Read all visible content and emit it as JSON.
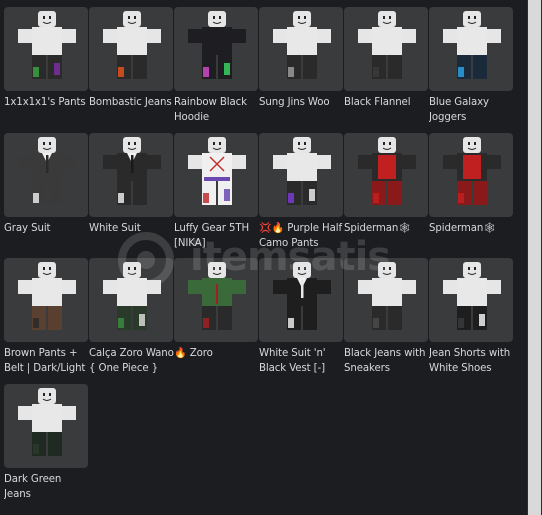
{
  "items": [
    {
      "name": "1x1x1x1's Pants",
      "torso": "#e8e8e8",
      "legs": "#2a2a2a",
      "accent": "#3aa040",
      "accent2": "#7a2fa0",
      "tie": ""
    },
    {
      "name": "Bombastic Jeans",
      "torso": "#e8e8e8",
      "legs": "#2a2a2a",
      "accent": "#e0521e",
      "accent2": "#2a2a2a",
      "tie": ""
    },
    {
      "name": "Rainbow Black Hoodie",
      "torso": "#1e1e22",
      "legs": "#1e1e22",
      "accent": "#d04ac8",
      "accent2": "#3ad060",
      "tie": ""
    },
    {
      "name": "Sung Jins Woo",
      "torso": "#e8e8e8",
      "legs": "#2a2a2a",
      "accent": "#9a9a9a",
      "accent2": "#2a2a2a",
      "tie": ""
    },
    {
      "name": "Black Flannel",
      "torso": "#e8e8e8",
      "legs": "#2a2a2a",
      "accent": "#3a3a3a",
      "accent2": "#2a2a2a",
      "tie": ""
    },
    {
      "name": "Blue Galaxy Joggers",
      "torso": "#e8e8e8",
      "legs": "#1a2a3a",
      "accent": "#2aa0e0",
      "accent2": "#1a2a3a",
      "tie": ""
    },
    {
      "name": "Gray Suit",
      "torso": "#3a3a3a",
      "legs": "#3a3a3a",
      "accent": "#e8e8e8",
      "accent2": "#3a3a3a",
      "tie": "#2a2a2a"
    },
    {
      "name": "White Suit",
      "torso": "#2a2a2a",
      "legs": "#2a2a2a",
      "accent": "#e8e8e8",
      "accent2": "#2a2a2a",
      "tie": "#1a1a1a"
    },
    {
      "name": "Luffy Gear 5TH [NIKA]",
      "torso": "#f0f0f0",
      "legs": "#f0f0f0",
      "accent": "#c03030",
      "accent2": "#6a4ab0",
      "tie": ""
    },
    {
      "name": "💢🔥 Purple Half Camo Pants",
      "torso": "#e8e8e8",
      "legs": "#2a2a2a",
      "accent": "#7a3ad0",
      "accent2": "#e8e8e8",
      "tie": ""
    },
    {
      "name": "Spiderman🕸",
      "torso": "#2a2a2a",
      "legs": "#8a1a1a",
      "accent": "#c02020",
      "accent2": "#8a1a1a",
      "tie": ""
    },
    {
      "name": "Spiderman🕸",
      "torso": "#2a2a2a",
      "legs": "#8a1a1a",
      "accent": "#c02020",
      "accent2": "#8a1a1a",
      "tie": ""
    },
    {
      "name": "Brown Pants + Belt | Dark/Light",
      "torso": "#e8e8e8",
      "legs": "#5a4030",
      "accent": "#2a2a2a",
      "accent2": "#5a4030",
      "tie": ""
    },
    {
      "name": "Calça Zoro Wano { One Piece }",
      "torso": "#e8e8e8",
      "legs": "#2a3a2a",
      "accent": "#3a8a40",
      "accent2": "#d8d8d8",
      "tie": ""
    },
    {
      "name": "🔥 Zoro",
      "torso": "#3a6a3a",
      "legs": "#2a2a2a",
      "accent": "#a02020",
      "accent2": "#2a2a2a",
      "tie": ""
    },
    {
      "name": "White Suit 'n' Black Vest [-]",
      "torso": "#1e1e1e",
      "legs": "#1e1e1e",
      "accent": "#e8e8e8",
      "accent2": "#1e1e1e",
      "tie": "#e8e8e8"
    },
    {
      "name": "Black Jeans with Sneakers",
      "torso": "#e8e8e8",
      "legs": "#2a2a2a",
      "accent": "#4a4a4a",
      "accent2": "#2a2a2a",
      "tie": ""
    },
    {
      "name": "Jean Shorts with White Shoes",
      "torso": "#e8e8e8",
      "legs": "#1e1e1e",
      "accent": "#3a3a3a",
      "accent2": "#f0f0f0",
      "tie": ""
    },
    {
      "name": "Dark Green Jeans",
      "torso": "#e8e8e8",
      "legs": "#1e2a22",
      "accent": "#2a3a2a",
      "accent2": "#1e2a22",
      "tie": ""
    }
  ],
  "watermark": {
    "brand": "itemsatis"
  },
  "colors": {
    "background": "#1b1d20",
    "tile": "#393b3d",
    "text": "#d6d8da",
    "scrollbar_thumb": "#d9d9d9"
  }
}
